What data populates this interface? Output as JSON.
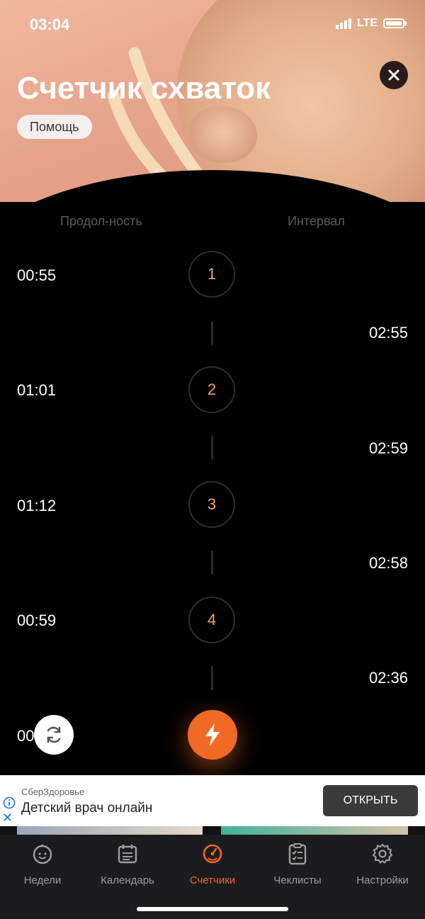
{
  "status_bar": {
    "time": "03:04",
    "network": "LTE"
  },
  "header": {
    "title": "Счетчик схваток",
    "help_label": "Помощь"
  },
  "columns": {
    "duration": "Продол-ность",
    "interval": "Интервал"
  },
  "contractions": [
    {
      "number": "1",
      "duration": "00:55",
      "interval": "02:55"
    },
    {
      "number": "2",
      "duration": "01:01",
      "interval": "02:59"
    },
    {
      "number": "3",
      "duration": "01:12",
      "interval": "02:58"
    },
    {
      "number": "4",
      "duration": "00:59",
      "interval": "02:36"
    },
    {
      "partial_duration": "00"
    }
  ],
  "ad": {
    "sponsor": "СберЗдоровье",
    "title": "Детский врач онлайн",
    "button": "ОТКРЫТЬ"
  },
  "tabs": [
    {
      "label": "Недели",
      "icon": "baby-face-icon"
    },
    {
      "label": "Календарь",
      "icon": "calendar-icon"
    },
    {
      "label": "Счетчики",
      "icon": "stopwatch-icon",
      "active": true
    },
    {
      "label": "Чеклисты",
      "icon": "checklist-icon"
    },
    {
      "label": "Настройки",
      "icon": "gear-icon"
    }
  ],
  "colors": {
    "accent": "#F06A25",
    "number": "#F4A264",
    "background": "#000000",
    "tab_bar": "#1C1C1E"
  }
}
